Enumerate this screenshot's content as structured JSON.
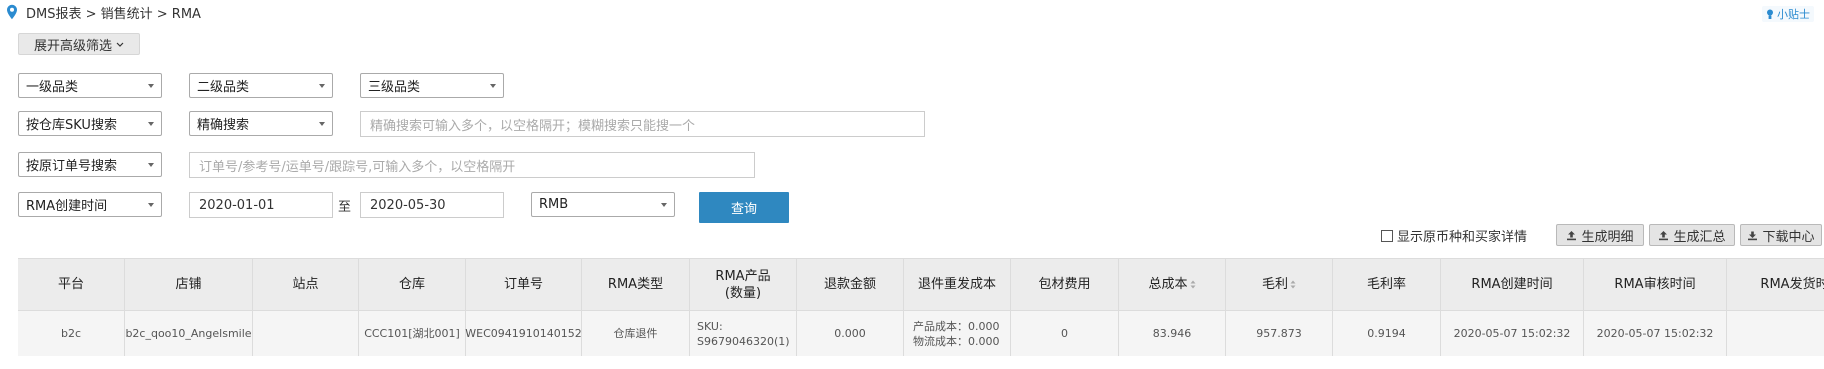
{
  "breadcrumb": "DMS报表 > 销售统计 > RMA",
  "tip_label": "小贴士",
  "toolbar": {
    "advanced_filter": "展开高级筛选"
  },
  "filters": {
    "category_1": "一级品类",
    "category_2": "二级品类",
    "category_3": "三级品类",
    "sku_search_type": "按仓库SKU搜索",
    "match_mode": "精确搜索",
    "sku_placeholder": "精确搜索可输入多个，以空格隔开；模糊搜索只能搜一个",
    "order_search_type": "按原订单号搜索",
    "order_placeholder": "订单号/参考号/运单号/跟踪号,可输入多个，以空格隔开",
    "date_type": "RMA创建时间",
    "date_from": "2020-01-01",
    "date_sep": "至",
    "date_to": "2020-05-30",
    "currency": "RMB",
    "query": "查询"
  },
  "actions": {
    "show_currency_detail": "显示原币种和买家详情",
    "gen_detail": "生成明细",
    "gen_summary": "生成汇总",
    "download_center": "下载中心"
  },
  "table": {
    "columns": {
      "platform": "平台",
      "store": "店铺",
      "site": "站点",
      "warehouse": "仓库",
      "order_no": "订单号",
      "rma_type": "RMA类型",
      "rma_product_l1": "RMA产品",
      "rma_product_l2": "(数量)",
      "refund": "退款金额",
      "reship_cost": "退件重发成本",
      "packing": "包材费用",
      "total_cost": "总成本",
      "gross_profit": "毛利",
      "gross_margin": "毛利率",
      "rma_created": "RMA创建时间",
      "rma_reviewed": "RMA审核时间",
      "rma_shipped": "RMA发货时间"
    },
    "rows": [
      {
        "platform": "b2c",
        "store": "b2c_qoo10_Angelsmile",
        "site": "",
        "warehouse": "CCC101[湖北001]",
        "order_no": "WEC0941910140152",
        "rma_type": "仓库退件",
        "product_l1": "SKU:",
        "product_l2": "S9679046320(1)",
        "refund": "0.000",
        "product_cost": "产品成本：0.000",
        "logistics_cost": "物流成本：0.000",
        "packing": "0",
        "total_cost": "83.946",
        "gross_profit": "957.873",
        "gross_margin": "0.9194",
        "rma_created": "2020-05-07 15:02:32",
        "rma_reviewed": "2020-05-07 15:02:32",
        "rma_shipped": ""
      }
    ]
  }
}
